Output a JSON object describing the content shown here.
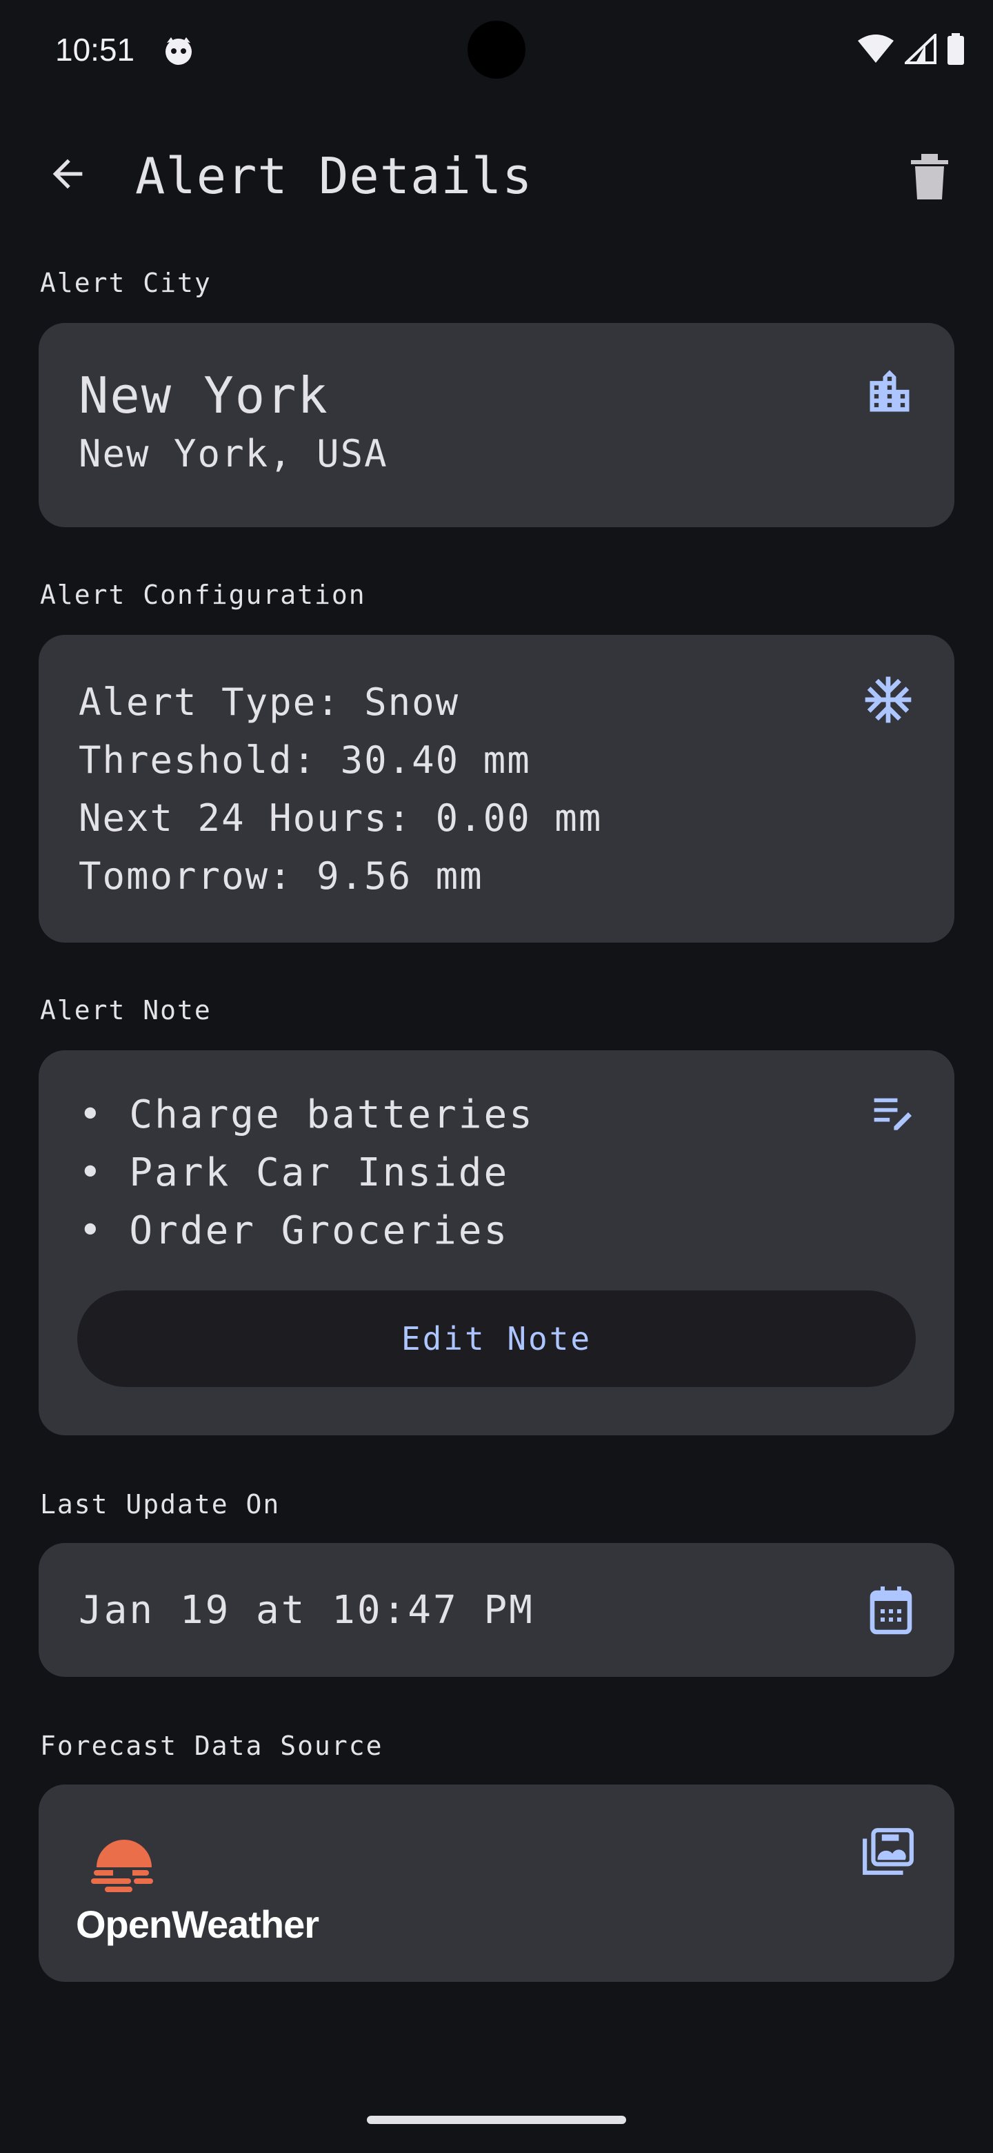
{
  "status_bar": {
    "time": "10:51"
  },
  "app_bar": {
    "title": "Alert Details",
    "back_icon": "arrow-back-icon",
    "delete_icon": "trash-icon"
  },
  "sections": {
    "city_label": "Alert City",
    "config_label": "Alert Configuration",
    "note_label": "Alert Note",
    "update_label": "Last Update On",
    "source_label": "Forecast Data Source"
  },
  "city": {
    "name": "New York",
    "region": "New York, USA",
    "icon": "city-buildings-icon"
  },
  "config": {
    "lines": [
      "Alert Type: Snow",
      "Threshold: 30.40 mm",
      "Next 24 Hours: 0.00 mm",
      "Tomorrow: 9.56 mm"
    ],
    "icon": "snowflake-icon"
  },
  "note": {
    "items": [
      "• Charge batteries",
      "• Park Car Inside",
      "• Order Groceries"
    ],
    "edit_button_label": "Edit Note",
    "icon": "edit-note-icon"
  },
  "last_update": {
    "value": "Jan 19 at 10:47 PM",
    "icon": "calendar-icon"
  },
  "source": {
    "name": "OpenWeather",
    "icon": "photo-library-icon"
  },
  "colors": {
    "background": "#121317",
    "card": "#34353b",
    "accent": "#aec6ff",
    "openweather_orange": "#eb6e4b"
  }
}
